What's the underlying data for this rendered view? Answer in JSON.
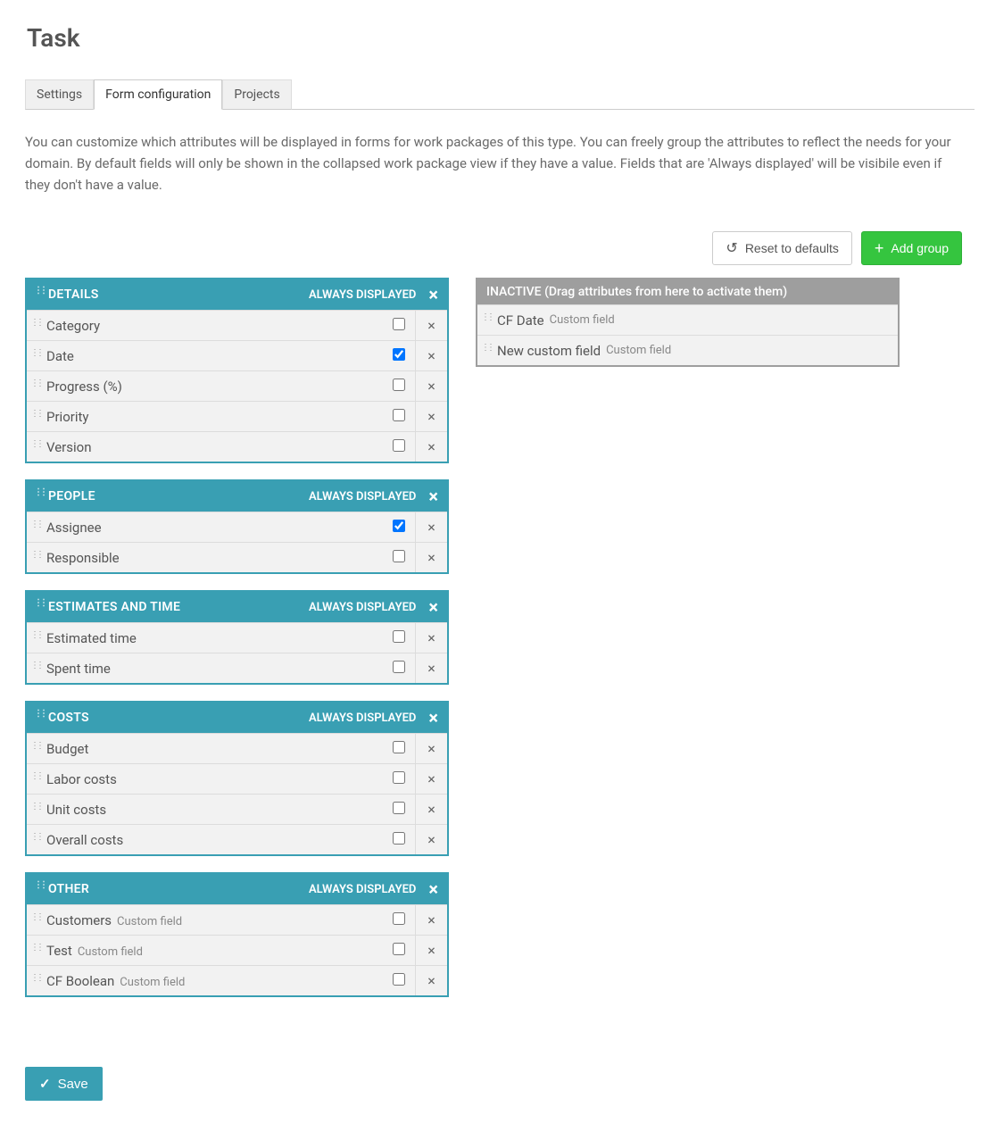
{
  "page_title": "Task",
  "tabs": [
    {
      "label": "Settings",
      "active": false
    },
    {
      "label": "Form configuration",
      "active": true
    },
    {
      "label": "Projects",
      "active": false
    }
  ],
  "description": "You can customize which attributes will be displayed in forms for work packages of this type. You can freely group the attributes to reflect the needs for your domain. By default fields will only be shown in the collapsed work package view if they have a value. Fields that are 'Always displayed' will be visibile even if they don't have a value.",
  "toolbar": {
    "reset_label": "Reset to defaults",
    "add_group_label": "Add group"
  },
  "always_displayed_label": "ALWAYS DISPLAYED",
  "groups": [
    {
      "name": "DETAILS",
      "fields": [
        {
          "label": "Category",
          "always": false
        },
        {
          "label": "Date",
          "always": true
        },
        {
          "label": "Progress (%)",
          "always": false
        },
        {
          "label": "Priority",
          "always": false
        },
        {
          "label": "Version",
          "always": false
        }
      ]
    },
    {
      "name": "PEOPLE",
      "fields": [
        {
          "label": "Assignee",
          "always": true
        },
        {
          "label": "Responsible",
          "always": false
        }
      ]
    },
    {
      "name": "ESTIMATES AND TIME",
      "fields": [
        {
          "label": "Estimated time",
          "always": false
        },
        {
          "label": "Spent time",
          "always": false
        }
      ]
    },
    {
      "name": "COSTS",
      "fields": [
        {
          "label": "Budget",
          "always": false
        },
        {
          "label": "Labor costs",
          "always": false
        },
        {
          "label": "Unit costs",
          "always": false
        },
        {
          "label": "Overall costs",
          "always": false
        }
      ]
    },
    {
      "name": "OTHER",
      "fields": [
        {
          "label": "Customers",
          "suffix": "Custom field",
          "always": false
        },
        {
          "label": "Test",
          "suffix": "Custom field",
          "always": false
        },
        {
          "label": "CF Boolean",
          "suffix": "Custom field",
          "always": false
        }
      ]
    }
  ],
  "inactive": {
    "header": "INACTIVE (Drag attributes from here to activate them)",
    "fields": [
      {
        "label": "CF Date",
        "suffix": "Custom field"
      },
      {
        "label": "New custom field",
        "suffix": "Custom field"
      }
    ]
  },
  "save_label": "Save"
}
